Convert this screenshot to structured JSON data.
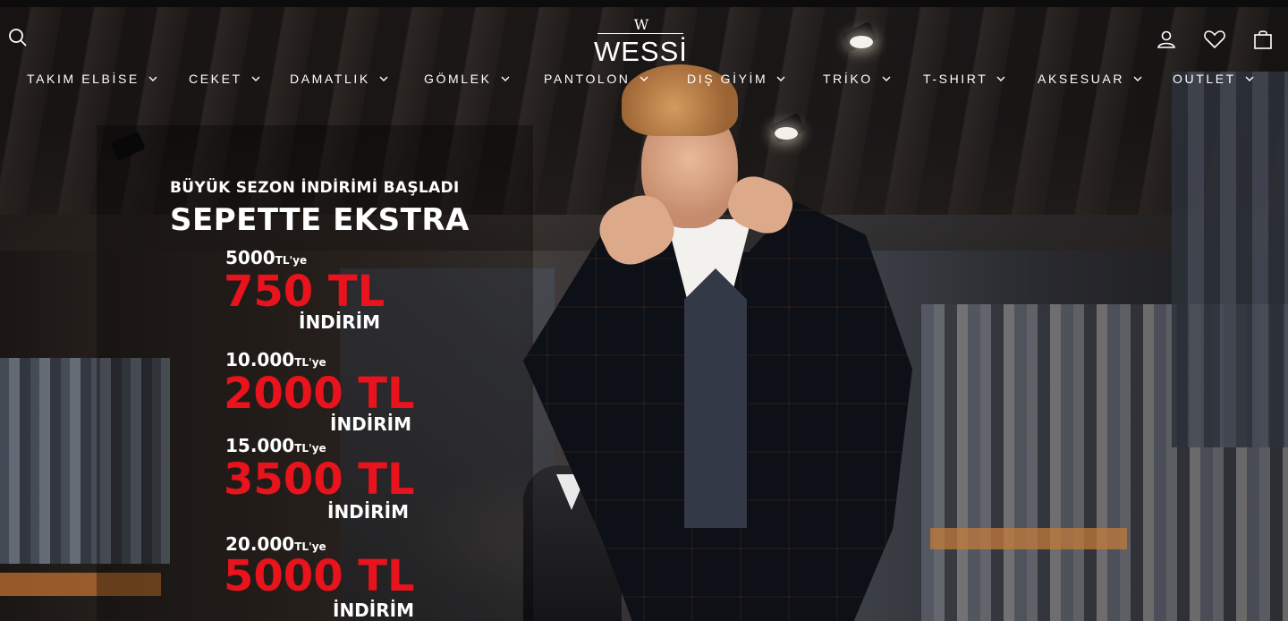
{
  "brand": {
    "logo_mark": "W",
    "logo_text": "WESSİ"
  },
  "header": {
    "icons": [
      "search-icon",
      "user-icon",
      "heart-icon",
      "cart-icon"
    ]
  },
  "nav": {
    "items": [
      {
        "label": "TAKIM ELBİSE"
      },
      {
        "label": "CEKET"
      },
      {
        "label": "DAMATLIK"
      },
      {
        "label": "GÖMLEK"
      },
      {
        "label": "PANTOLON"
      },
      {
        "label": "DIŞ GİYİM"
      },
      {
        "label": "TRİKO"
      },
      {
        "label": "T-SHIRT"
      },
      {
        "label": "AKSESUAR"
      },
      {
        "label": "OUTLET"
      }
    ]
  },
  "promo": {
    "headline_small": "BÜYÜK SEZON İNDİRİMİ BAŞLADI",
    "headline_big": "SEPETTE EKSTRA",
    "accent_color": "#e8131c",
    "tiers": [
      {
        "threshold": "5000",
        "unit": "TL'ye",
        "amount": "750 TL",
        "label": "İNDİRİM"
      },
      {
        "threshold": "10.000",
        "unit": "TL'ye",
        "amount": "2000 TL",
        "label": "İNDİRİM"
      },
      {
        "threshold": "15.000",
        "unit": "TL'ye",
        "amount": "3500 TL",
        "label": "İNDİRİM"
      },
      {
        "threshold": "20.000",
        "unit": "TL'ye",
        "amount": "5000 TL",
        "label": "İNDİRİM"
      }
    ]
  }
}
